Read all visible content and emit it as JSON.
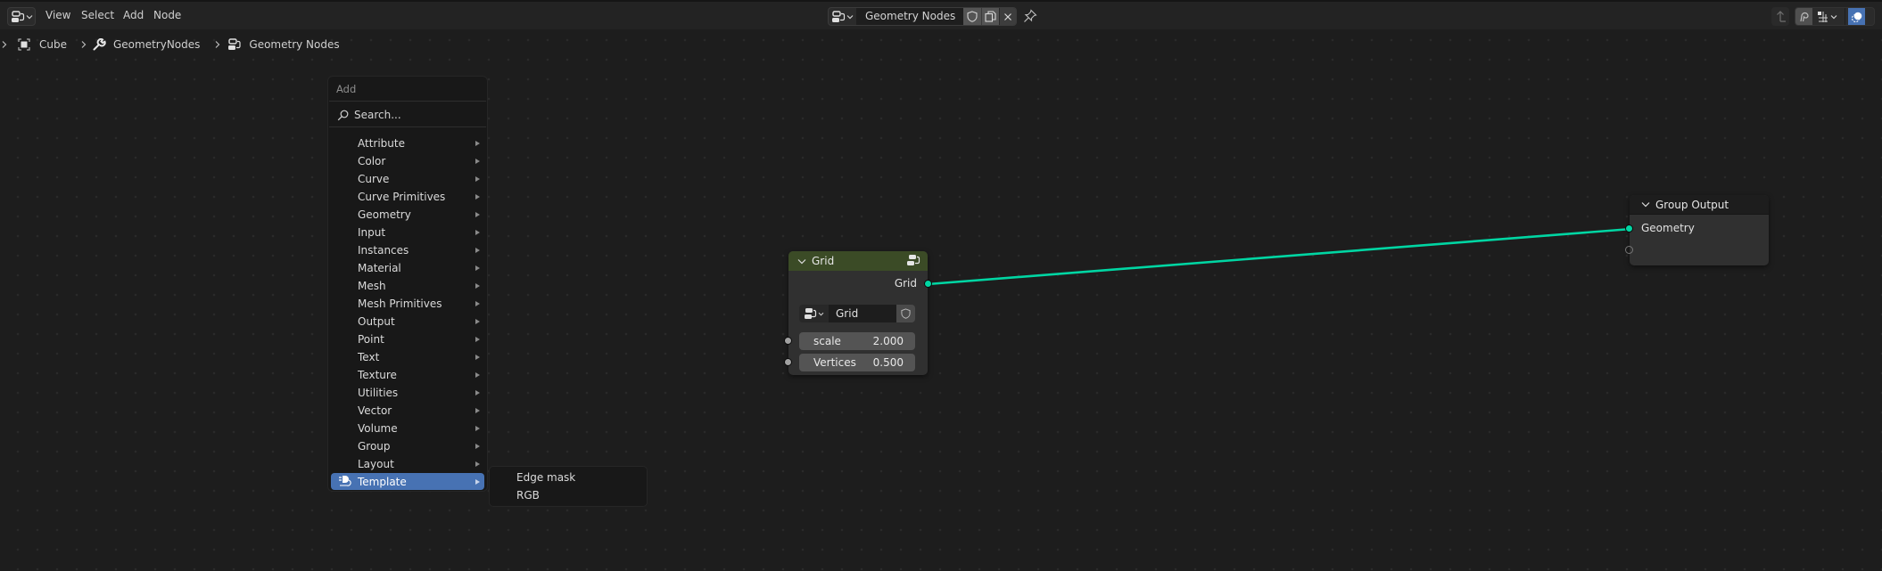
{
  "header": {
    "editor_type_icon": "node-editor-icon",
    "menus": [
      "View",
      "Select",
      "Add",
      "Node"
    ],
    "node_tree": {
      "icon": "node-tree-icon",
      "name": "Geometry Nodes",
      "fake_user_icon": "shield-icon",
      "duplicate_icon": "duplicate-icon",
      "unlink_icon": "close-icon",
      "pin_icon": "pin-icon"
    },
    "right_tools": [
      "parent-node-icon",
      "snap-icon",
      "snap-grid-icon",
      "overlay-icon"
    ]
  },
  "breadcrumb": {
    "items": [
      {
        "icon": "object-icon",
        "label": "Cube"
      },
      {
        "icon": "wrench-icon",
        "label": "GeometryNodes"
      },
      {
        "icon": "node-tree-icon",
        "label": "Geometry Nodes"
      }
    ]
  },
  "add_menu": {
    "title": "Add",
    "search_placeholder": "Search...",
    "items": [
      {
        "label": "Attribute"
      },
      {
        "label": "Color"
      },
      {
        "label": "Curve"
      },
      {
        "label": "Curve Primitives"
      },
      {
        "label": "Geometry"
      },
      {
        "label": "Input"
      },
      {
        "label": "Instances"
      },
      {
        "label": "Material"
      },
      {
        "label": "Mesh"
      },
      {
        "label": "Mesh Primitives"
      },
      {
        "label": "Output"
      },
      {
        "label": "Point"
      },
      {
        "label": "Text"
      },
      {
        "label": "Texture"
      },
      {
        "label": "Utilities"
      },
      {
        "label": "Vector"
      },
      {
        "label": "Volume"
      },
      {
        "label": "Group"
      },
      {
        "label": "Layout"
      },
      {
        "label": "Template",
        "active": true
      }
    ],
    "active_color": "#4772b3"
  },
  "submenu": {
    "items": [
      "Edge mask",
      "RGB"
    ]
  },
  "grid_node": {
    "title": "Grid",
    "header_color": "#3b4b26",
    "output_label": "Grid",
    "group_name": "Grid",
    "inputs": [
      {
        "label": "scale",
        "value": "2.000"
      },
      {
        "label": "Vertices",
        "value": "0.500"
      }
    ]
  },
  "group_output_node": {
    "title": "Group Output",
    "inputs": [
      {
        "label": "Geometry"
      },
      {
        "label": ""
      }
    ]
  },
  "link_color": "#00d6a3"
}
